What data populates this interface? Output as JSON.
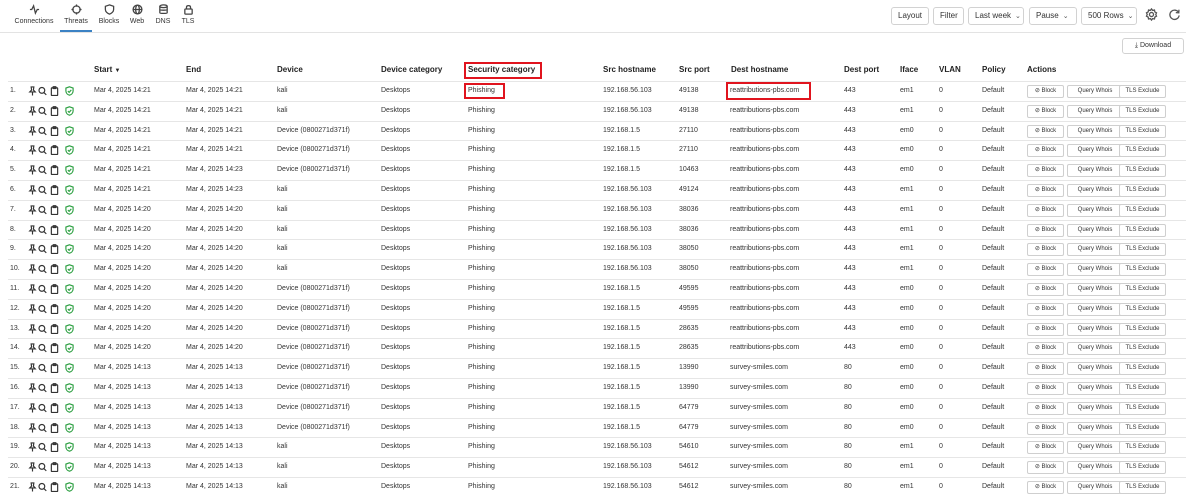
{
  "nav": [
    {
      "label": "Connections",
      "icon": "activity-icon"
    },
    {
      "label": "Threats",
      "icon": "crosshair-icon"
    },
    {
      "label": "Blocks",
      "icon": "shield-icon"
    },
    {
      "label": "Web",
      "icon": "globe-icon"
    },
    {
      "label": "DNS",
      "icon": "database-icon"
    },
    {
      "label": "TLS",
      "icon": "lock-icon"
    }
  ],
  "toolbar": {
    "layout": "Layout",
    "filter": "Filter",
    "range": "Last week",
    "pause": "Pause",
    "rows": "500 Rows",
    "settings_icon": "gear-icon",
    "refresh_icon": "refresh-icon"
  },
  "download_label": "Download",
  "columns": {
    "start": "Start",
    "end": "End",
    "device": "Device",
    "device_category": "Device category",
    "security_category": "Security category",
    "src_hostname": "Src hostname",
    "src_port": "Src port",
    "dest_hostname": "Dest hostname",
    "dest_port": "Dest port",
    "iface": "Iface",
    "vlan": "VLAN",
    "policy": "Policy",
    "actions": "Actions"
  },
  "sort_indicator": "▼",
  "actions": {
    "block": "⊘ Block",
    "whois": "Query Whois",
    "tls": "TLS Exclude"
  },
  "rows": [
    {
      "n": "1.",
      "start": "Mar 4, 2025 14:21",
      "end": "Mar 4, 2025 14:21",
      "device": "kali",
      "cat": "Desktops",
      "sec": "Phishing",
      "src": "192.168.56.103",
      "sport": "49138",
      "dest": "reattributions-pbs.com",
      "dport": "443",
      "iface": "em1",
      "vlan": "0",
      "policy": "Default"
    },
    {
      "n": "2.",
      "start": "Mar 4, 2025 14:21",
      "end": "Mar 4, 2025 14:21",
      "device": "kali",
      "cat": "Desktops",
      "sec": "Phishing",
      "src": "192.168.56.103",
      "sport": "49138",
      "dest": "reattributions-pbs.com",
      "dport": "443",
      "iface": "em1",
      "vlan": "0",
      "policy": "Default"
    },
    {
      "n": "3.",
      "start": "Mar 4, 2025 14:21",
      "end": "Mar 4, 2025 14:21",
      "device": "Device (0800271d371f)",
      "cat": "Desktops",
      "sec": "Phishing",
      "src": "192.168.1.5",
      "sport": "27110",
      "dest": "reattributions-pbs.com",
      "dport": "443",
      "iface": "em0",
      "vlan": "0",
      "policy": "Default"
    },
    {
      "n": "4.",
      "start": "Mar 4, 2025 14:21",
      "end": "Mar 4, 2025 14:21",
      "device": "Device (0800271d371f)",
      "cat": "Desktops",
      "sec": "Phishing",
      "src": "192.168.1.5",
      "sport": "27110",
      "dest": "reattributions-pbs.com",
      "dport": "443",
      "iface": "em0",
      "vlan": "0",
      "policy": "Default"
    },
    {
      "n": "5.",
      "start": "Mar 4, 2025 14:21",
      "end": "Mar 4, 2025 14:23",
      "device": "Device (0800271d371f)",
      "cat": "Desktops",
      "sec": "Phishing",
      "src": "192.168.1.5",
      "sport": "10463",
      "dest": "reattributions-pbs.com",
      "dport": "443",
      "iface": "em0",
      "vlan": "0",
      "policy": "Default"
    },
    {
      "n": "6.",
      "start": "Mar 4, 2025 14:21",
      "end": "Mar 4, 2025 14:23",
      "device": "kali",
      "cat": "Desktops",
      "sec": "Phishing",
      "src": "192.168.56.103",
      "sport": "49124",
      "dest": "reattributions-pbs.com",
      "dport": "443",
      "iface": "em1",
      "vlan": "0",
      "policy": "Default"
    },
    {
      "n": "7.",
      "start": "Mar 4, 2025 14:20",
      "end": "Mar 4, 2025 14:20",
      "device": "kali",
      "cat": "Desktops",
      "sec": "Phishing",
      "src": "192.168.56.103",
      "sport": "38036",
      "dest": "reattributions-pbs.com",
      "dport": "443",
      "iface": "em1",
      "vlan": "0",
      "policy": "Default"
    },
    {
      "n": "8.",
      "start": "Mar 4, 2025 14:20",
      "end": "Mar 4, 2025 14:20",
      "device": "kali",
      "cat": "Desktops",
      "sec": "Phishing",
      "src": "192.168.56.103",
      "sport": "38036",
      "dest": "reattributions-pbs.com",
      "dport": "443",
      "iface": "em1",
      "vlan": "0",
      "policy": "Default"
    },
    {
      "n": "9.",
      "start": "Mar 4, 2025 14:20",
      "end": "Mar 4, 2025 14:20",
      "device": "kali",
      "cat": "Desktops",
      "sec": "Phishing",
      "src": "192.168.56.103",
      "sport": "38050",
      "dest": "reattributions-pbs.com",
      "dport": "443",
      "iface": "em1",
      "vlan": "0",
      "policy": "Default"
    },
    {
      "n": "10.",
      "start": "Mar 4, 2025 14:20",
      "end": "Mar 4, 2025 14:20",
      "device": "kali",
      "cat": "Desktops",
      "sec": "Phishing",
      "src": "192.168.56.103",
      "sport": "38050",
      "dest": "reattributions-pbs.com",
      "dport": "443",
      "iface": "em1",
      "vlan": "0",
      "policy": "Default"
    },
    {
      "n": "11.",
      "start": "Mar 4, 2025 14:20",
      "end": "Mar 4, 2025 14:20",
      "device": "Device (0800271d371f)",
      "cat": "Desktops",
      "sec": "Phishing",
      "src": "192.168.1.5",
      "sport": "49595",
      "dest": "reattributions-pbs.com",
      "dport": "443",
      "iface": "em0",
      "vlan": "0",
      "policy": "Default"
    },
    {
      "n": "12.",
      "start": "Mar 4, 2025 14:20",
      "end": "Mar 4, 2025 14:20",
      "device": "Device (0800271d371f)",
      "cat": "Desktops",
      "sec": "Phishing",
      "src": "192.168.1.5",
      "sport": "49595",
      "dest": "reattributions-pbs.com",
      "dport": "443",
      "iface": "em0",
      "vlan": "0",
      "policy": "Default"
    },
    {
      "n": "13.",
      "start": "Mar 4, 2025 14:20",
      "end": "Mar 4, 2025 14:20",
      "device": "Device (0800271d371f)",
      "cat": "Desktops",
      "sec": "Phishing",
      "src": "192.168.1.5",
      "sport": "28635",
      "dest": "reattributions-pbs.com",
      "dport": "443",
      "iface": "em0",
      "vlan": "0",
      "policy": "Default"
    },
    {
      "n": "14.",
      "start": "Mar 4, 2025 14:20",
      "end": "Mar 4, 2025 14:20",
      "device": "Device (0800271d371f)",
      "cat": "Desktops",
      "sec": "Phishing",
      "src": "192.168.1.5",
      "sport": "28635",
      "dest": "reattributions-pbs.com",
      "dport": "443",
      "iface": "em0",
      "vlan": "0",
      "policy": "Default"
    },
    {
      "n": "15.",
      "start": "Mar 4, 2025 14:13",
      "end": "Mar 4, 2025 14:13",
      "device": "Device (0800271d371f)",
      "cat": "Desktops",
      "sec": "Phishing",
      "src": "192.168.1.5",
      "sport": "13990",
      "dest": "survey-smiles.com",
      "dport": "80",
      "iface": "em0",
      "vlan": "0",
      "policy": "Default"
    },
    {
      "n": "16.",
      "start": "Mar 4, 2025 14:13",
      "end": "Mar 4, 2025 14:13",
      "device": "Device (0800271d371f)",
      "cat": "Desktops",
      "sec": "Phishing",
      "src": "192.168.1.5",
      "sport": "13990",
      "dest": "survey-smiles.com",
      "dport": "80",
      "iface": "em0",
      "vlan": "0",
      "policy": "Default"
    },
    {
      "n": "17.",
      "start": "Mar 4, 2025 14:13",
      "end": "Mar 4, 2025 14:13",
      "device": "Device (0800271d371f)",
      "cat": "Desktops",
      "sec": "Phishing",
      "src": "192.168.1.5",
      "sport": "64779",
      "dest": "survey-smiles.com",
      "dport": "80",
      "iface": "em0",
      "vlan": "0",
      "policy": "Default"
    },
    {
      "n": "18.",
      "start": "Mar 4, 2025 14:13",
      "end": "Mar 4, 2025 14:13",
      "device": "Device (0800271d371f)",
      "cat": "Desktops",
      "sec": "Phishing",
      "src": "192.168.1.5",
      "sport": "64779",
      "dest": "survey-smiles.com",
      "dport": "80",
      "iface": "em0",
      "vlan": "0",
      "policy": "Default"
    },
    {
      "n": "19.",
      "start": "Mar 4, 2025 14:13",
      "end": "Mar 4, 2025 14:13",
      "device": "kali",
      "cat": "Desktops",
      "sec": "Phishing",
      "src": "192.168.56.103",
      "sport": "54610",
      "dest": "survey-smiles.com",
      "dport": "80",
      "iface": "em1",
      "vlan": "0",
      "policy": "Default"
    },
    {
      "n": "20.",
      "start": "Mar 4, 2025 14:13",
      "end": "Mar 4, 2025 14:13",
      "device": "kali",
      "cat": "Desktops",
      "sec": "Phishing",
      "src": "192.168.56.103",
      "sport": "54612",
      "dest": "survey-smiles.com",
      "dport": "80",
      "iface": "em1",
      "vlan": "0",
      "policy": "Default"
    },
    {
      "n": "21.",
      "start": "Mar 4, 2025 14:13",
      "end": "Mar 4, 2025 14:13",
      "device": "kali",
      "cat": "Desktops",
      "sec": "Phishing",
      "src": "192.168.56.103",
      "sport": "54612",
      "dest": "survey-smiles.com",
      "dport": "80",
      "iface": "em1",
      "vlan": "0",
      "policy": "Default"
    }
  ],
  "colors": {
    "accent": "#3b82c4",
    "highlight": "#e0141e",
    "shield": "#2ea043"
  }
}
